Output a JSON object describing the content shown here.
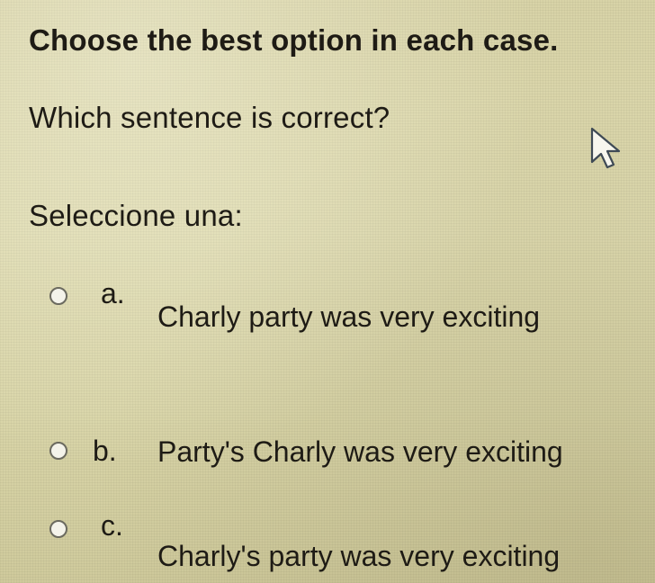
{
  "quiz": {
    "instruction": "Choose the best option in each case.",
    "question": "Which sentence is correct?",
    "select_prompt": "Seleccione una:",
    "options": [
      {
        "letter": "a.",
        "text": "Charly party was very exciting"
      },
      {
        "letter": "b.",
        "text": "Party's Charly was very exciting"
      },
      {
        "letter": "c.",
        "text": "Charly's party was very exciting"
      }
    ]
  },
  "cursor": {
    "icon": "arrow-pointer-icon"
  },
  "colors": {
    "background": "#d9d5a8",
    "text": "#1e1b15",
    "radio_border": "#6b6a5f",
    "radio_fill": "#f4f3ea"
  }
}
